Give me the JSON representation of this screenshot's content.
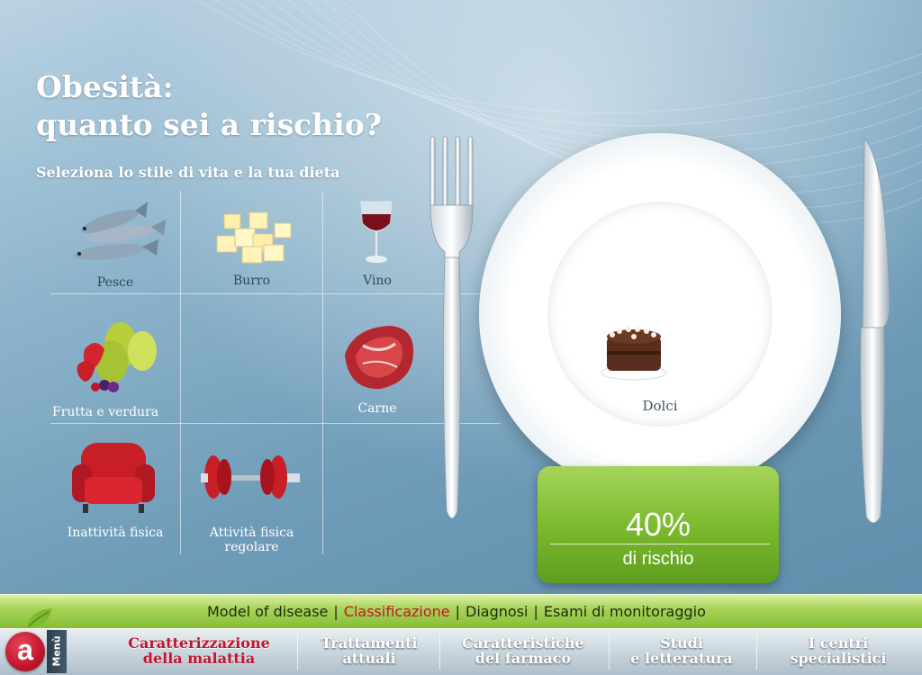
{
  "header": {
    "title_line1": "Obesità:",
    "title_line2": "quanto sei a rischio?",
    "subtitle": "Seleziona lo stile di vita e la tua dieta"
  },
  "foods": {
    "pesce": "Pesce",
    "burro": "Burro",
    "vino": "Vino",
    "frutta": "Frutta e verdura",
    "carne": "Carne",
    "inattivita": "Inattività fisica",
    "attivita_line1": "Attività fisica",
    "attivita_line2": "regolare"
  },
  "plate": {
    "item_label": "Dolci"
  },
  "risk": {
    "percent": "40%",
    "label": "di rischio",
    "value": 0.4
  },
  "subnav": {
    "items": [
      "Model of disease",
      "Classificazione",
      "Diagnosi",
      "Esami di monitoraggio"
    ],
    "active": "Classificazione",
    "separator": "|"
  },
  "menu_label": "Menù",
  "mainnav": {
    "items": [
      {
        "line1": "Caratterizzazione",
        "line2": "della malattia"
      },
      {
        "line1": "Trattamenti",
        "line2": "attuali"
      },
      {
        "line1": "Caratteristiche",
        "line2": "del farmaco"
      },
      {
        "line1": "Studi",
        "line2": "e letteratura"
      },
      {
        "line1": "I centri",
        "line2": "specialistici"
      }
    ]
  },
  "colors": {
    "accent_red": "#c0162b",
    "green": "#7cbb2e",
    "background_blue": "#6f9cb8"
  }
}
